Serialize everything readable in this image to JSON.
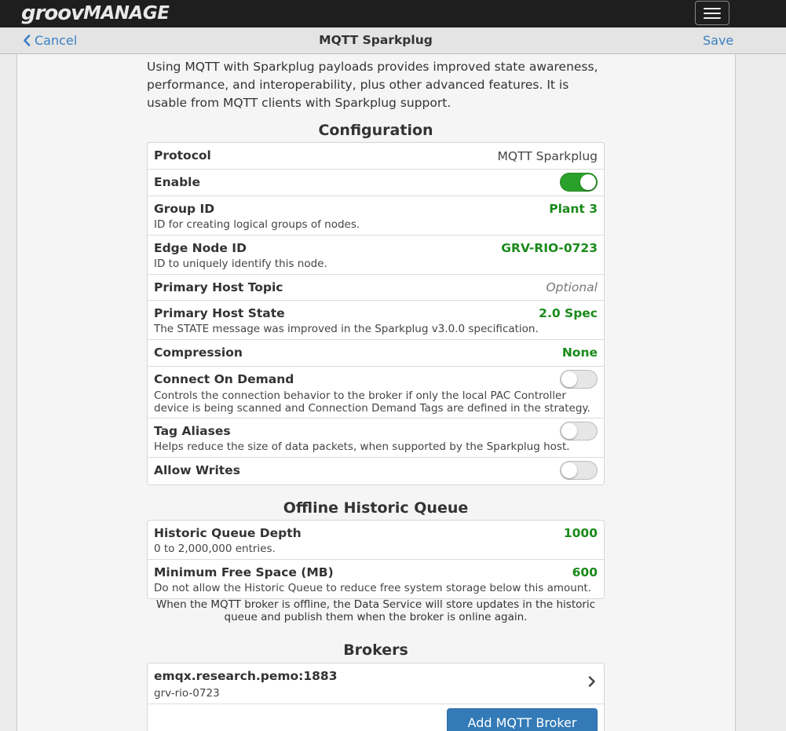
{
  "header": {
    "logo_part1": "groov",
    "logo_part2": "MANAGE",
    "menu_icon": "hamburger-icon"
  },
  "navbar": {
    "cancel_label": "Cancel",
    "title": "MQTT Sparkplug",
    "save_label": "Save",
    "link_color": "#3a82c4"
  },
  "intro_text": "Using MQTT with Sparkplug payloads provides improved state awareness, performance, and interoperability, plus other advanced features. It is usable from MQTT clients with Sparkplug support.",
  "configuration": {
    "title": "Configuration",
    "protocol": {
      "label": "Protocol",
      "value": "MQTT Sparkplug"
    },
    "enable": {
      "label": "Enable",
      "on": true
    },
    "group_id": {
      "label": "Group ID",
      "value": "Plant 3",
      "desc": "ID for creating logical groups of nodes."
    },
    "edge_node_id": {
      "label": "Edge Node ID",
      "value": "GRV-RIO-0723",
      "desc": "ID to uniquely identify this node."
    },
    "primary_host_topic": {
      "label": "Primary Host Topic",
      "value": "Optional"
    },
    "primary_host_state": {
      "label": "Primary Host State",
      "value": "2.0 Spec",
      "desc": "The STATE message was improved in the Sparkplug v3.0.0 specification."
    },
    "compression": {
      "label": "Compression",
      "value": "None"
    },
    "connect_on_demand": {
      "label": "Connect On Demand",
      "on": false,
      "desc": "Controls the connection behavior to the broker if only the local PAC Controller device is being scanned and Connection Demand Tags are defined in the strategy."
    },
    "tag_aliases": {
      "label": "Tag Aliases",
      "on": false,
      "desc": "Helps reduce the size of data packets, when supported by the Sparkplug host."
    },
    "allow_writes": {
      "label": "Allow Writes",
      "on": false
    }
  },
  "offline_queue": {
    "title": "Offline Historic Queue",
    "depth": {
      "label": "Historic Queue Depth",
      "value": "1000",
      "desc": "0 to 2,000,000 entries."
    },
    "min_free": {
      "label": "Minimum Free Space (MB)",
      "value": "600",
      "desc": "Do not allow the Historic Queue to reduce free system storage below this amount."
    },
    "note": "When the MQTT broker is offline, the Data Service will store updates in the historic queue and publish them when the broker is online again."
  },
  "brokers": {
    "title": "Brokers",
    "items": [
      {
        "host": "emqx.research.pemo:1883",
        "client": "grv-rio-0723"
      }
    ],
    "add_label": "Add MQTT Broker"
  },
  "colors": {
    "value_green": "#1a8a1a",
    "toggle_on": "#2aa12a",
    "primary_button": "#337ab7",
    "topbar": "#1e1e1e"
  }
}
